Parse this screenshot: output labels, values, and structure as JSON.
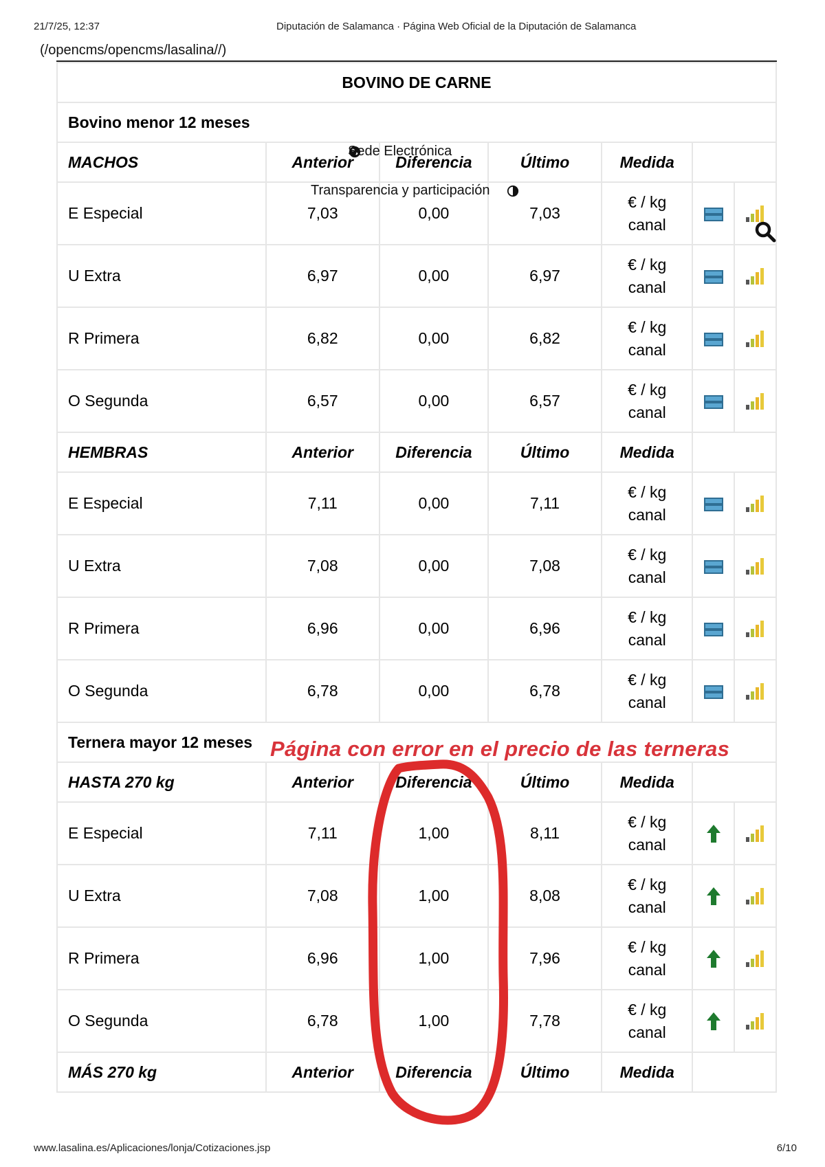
{
  "print_header": {
    "date": "21/7/25, 12:37",
    "title": "Diputación de Salamanca · Página Web Oficial de la Diputación de Salamanca"
  },
  "url_line": "(/opencms/opencms/lasalina//)",
  "overlays": {
    "sede": "Sede Electrónica",
    "transparencia": "Transparencia y participación"
  },
  "table": {
    "title": "BOVINO DE CARNE",
    "sections": [
      {
        "name": "Bovino menor 12 meses",
        "groups": [
          {
            "header": {
              "label": "MACHOS",
              "anterior": "Anterior",
              "diferencia": "Diferencia",
              "ultimo": "Último",
              "medida": "Medida"
            },
            "rows": [
              {
                "label": "E Especial",
                "anterior": "7,03",
                "diferencia": "0,00",
                "ultimo": "7,03",
                "unit1": "€ / kg",
                "unit2": "canal",
                "trend": "no-change"
              },
              {
                "label": "U Extra",
                "anterior": "6,97",
                "diferencia": "0,00",
                "ultimo": "6,97",
                "unit1": "€ / kg",
                "unit2": "canal",
                "trend": "no-change"
              },
              {
                "label": "R Primera",
                "anterior": "6,82",
                "diferencia": "0,00",
                "ultimo": "6,82",
                "unit1": "€ / kg",
                "unit2": "canal",
                "trend": "no-change"
              },
              {
                "label": "O Segunda",
                "anterior": "6,57",
                "diferencia": "0,00",
                "ultimo": "6,57",
                "unit1": "€ / kg",
                "unit2": "canal",
                "trend": "no-change"
              }
            ]
          },
          {
            "header": {
              "label": "HEMBRAS",
              "anterior": "Anterior",
              "diferencia": "Diferencia",
              "ultimo": "Último",
              "medida": "Medida"
            },
            "rows": [
              {
                "label": "E Especial",
                "anterior": "7,11",
                "diferencia": "0,00",
                "ultimo": "7,11",
                "unit1": "€ / kg",
                "unit2": "canal",
                "trend": "no-change"
              },
              {
                "label": "U Extra",
                "anterior": "7,08",
                "diferencia": "0,00",
                "ultimo": "7,08",
                "unit1": "€ / kg",
                "unit2": "canal",
                "trend": "no-change"
              },
              {
                "label": "R Primera",
                "anterior": "6,96",
                "diferencia": "0,00",
                "ultimo": "6,96",
                "unit1": "€ / kg",
                "unit2": "canal",
                "trend": "no-change"
              },
              {
                "label": "O Segunda",
                "anterior": "6,78",
                "diferencia": "0,00",
                "ultimo": "6,78",
                "unit1": "€ / kg",
                "unit2": "canal",
                "trend": "no-change"
              }
            ]
          }
        ]
      },
      {
        "name": "Ternera mayor 12 meses",
        "groups": [
          {
            "header": {
              "label": "HASTA 270 kg",
              "anterior": "Anterior",
              "diferencia": "Diferencia",
              "ultimo": "Último",
              "medida": "Medida"
            },
            "rows": [
              {
                "label": "E Especial",
                "anterior": "7,11",
                "diferencia": "1,00",
                "ultimo": "8,11",
                "unit1": "€ / kg",
                "unit2": "canal",
                "trend": "up"
              },
              {
                "label": "U Extra",
                "anterior": "7,08",
                "diferencia": "1,00",
                "ultimo": "8,08",
                "unit1": "€ / kg",
                "unit2": "canal",
                "trend": "up"
              },
              {
                "label": "R Primera",
                "anterior": "6,96",
                "diferencia": "1,00",
                "ultimo": "7,96",
                "unit1": "€ / kg",
                "unit2": "canal",
                "trend": "up"
              },
              {
                "label": "O Segunda",
                "anterior": "6,78",
                "diferencia": "1,00",
                "ultimo": "7,78",
                "unit1": "€ / kg",
                "unit2": "canal",
                "trend": "up"
              }
            ]
          },
          {
            "header": {
              "label": "MÁS 270 kg",
              "anterior": "Anterior",
              "diferencia": "Diferencia",
              "ultimo": "Último",
              "medida": "Medida"
            },
            "rows": []
          }
        ]
      }
    ]
  },
  "annotation": "Página con error en el precio de las terneras",
  "colors": {
    "no_change_fill": "#4a90b8",
    "up_arrow": "#1e7a2e",
    "annotation_red": "#d8333a",
    "bars": [
      "#555555",
      "#b5c23a",
      "#e8b82a",
      "#e8c93a"
    ]
  },
  "icons": {
    "no_change": "no-change-icon",
    "up": "up-arrow-icon",
    "chart": "bar-chart-icon",
    "globe": "globe-icon",
    "contrast": "contrast-icon",
    "search": "search-icon"
  },
  "print_footer": {
    "url": "www.lasalina.es/Aplicaciones/lonja/Cotizaciones.jsp",
    "page": "6/10"
  }
}
